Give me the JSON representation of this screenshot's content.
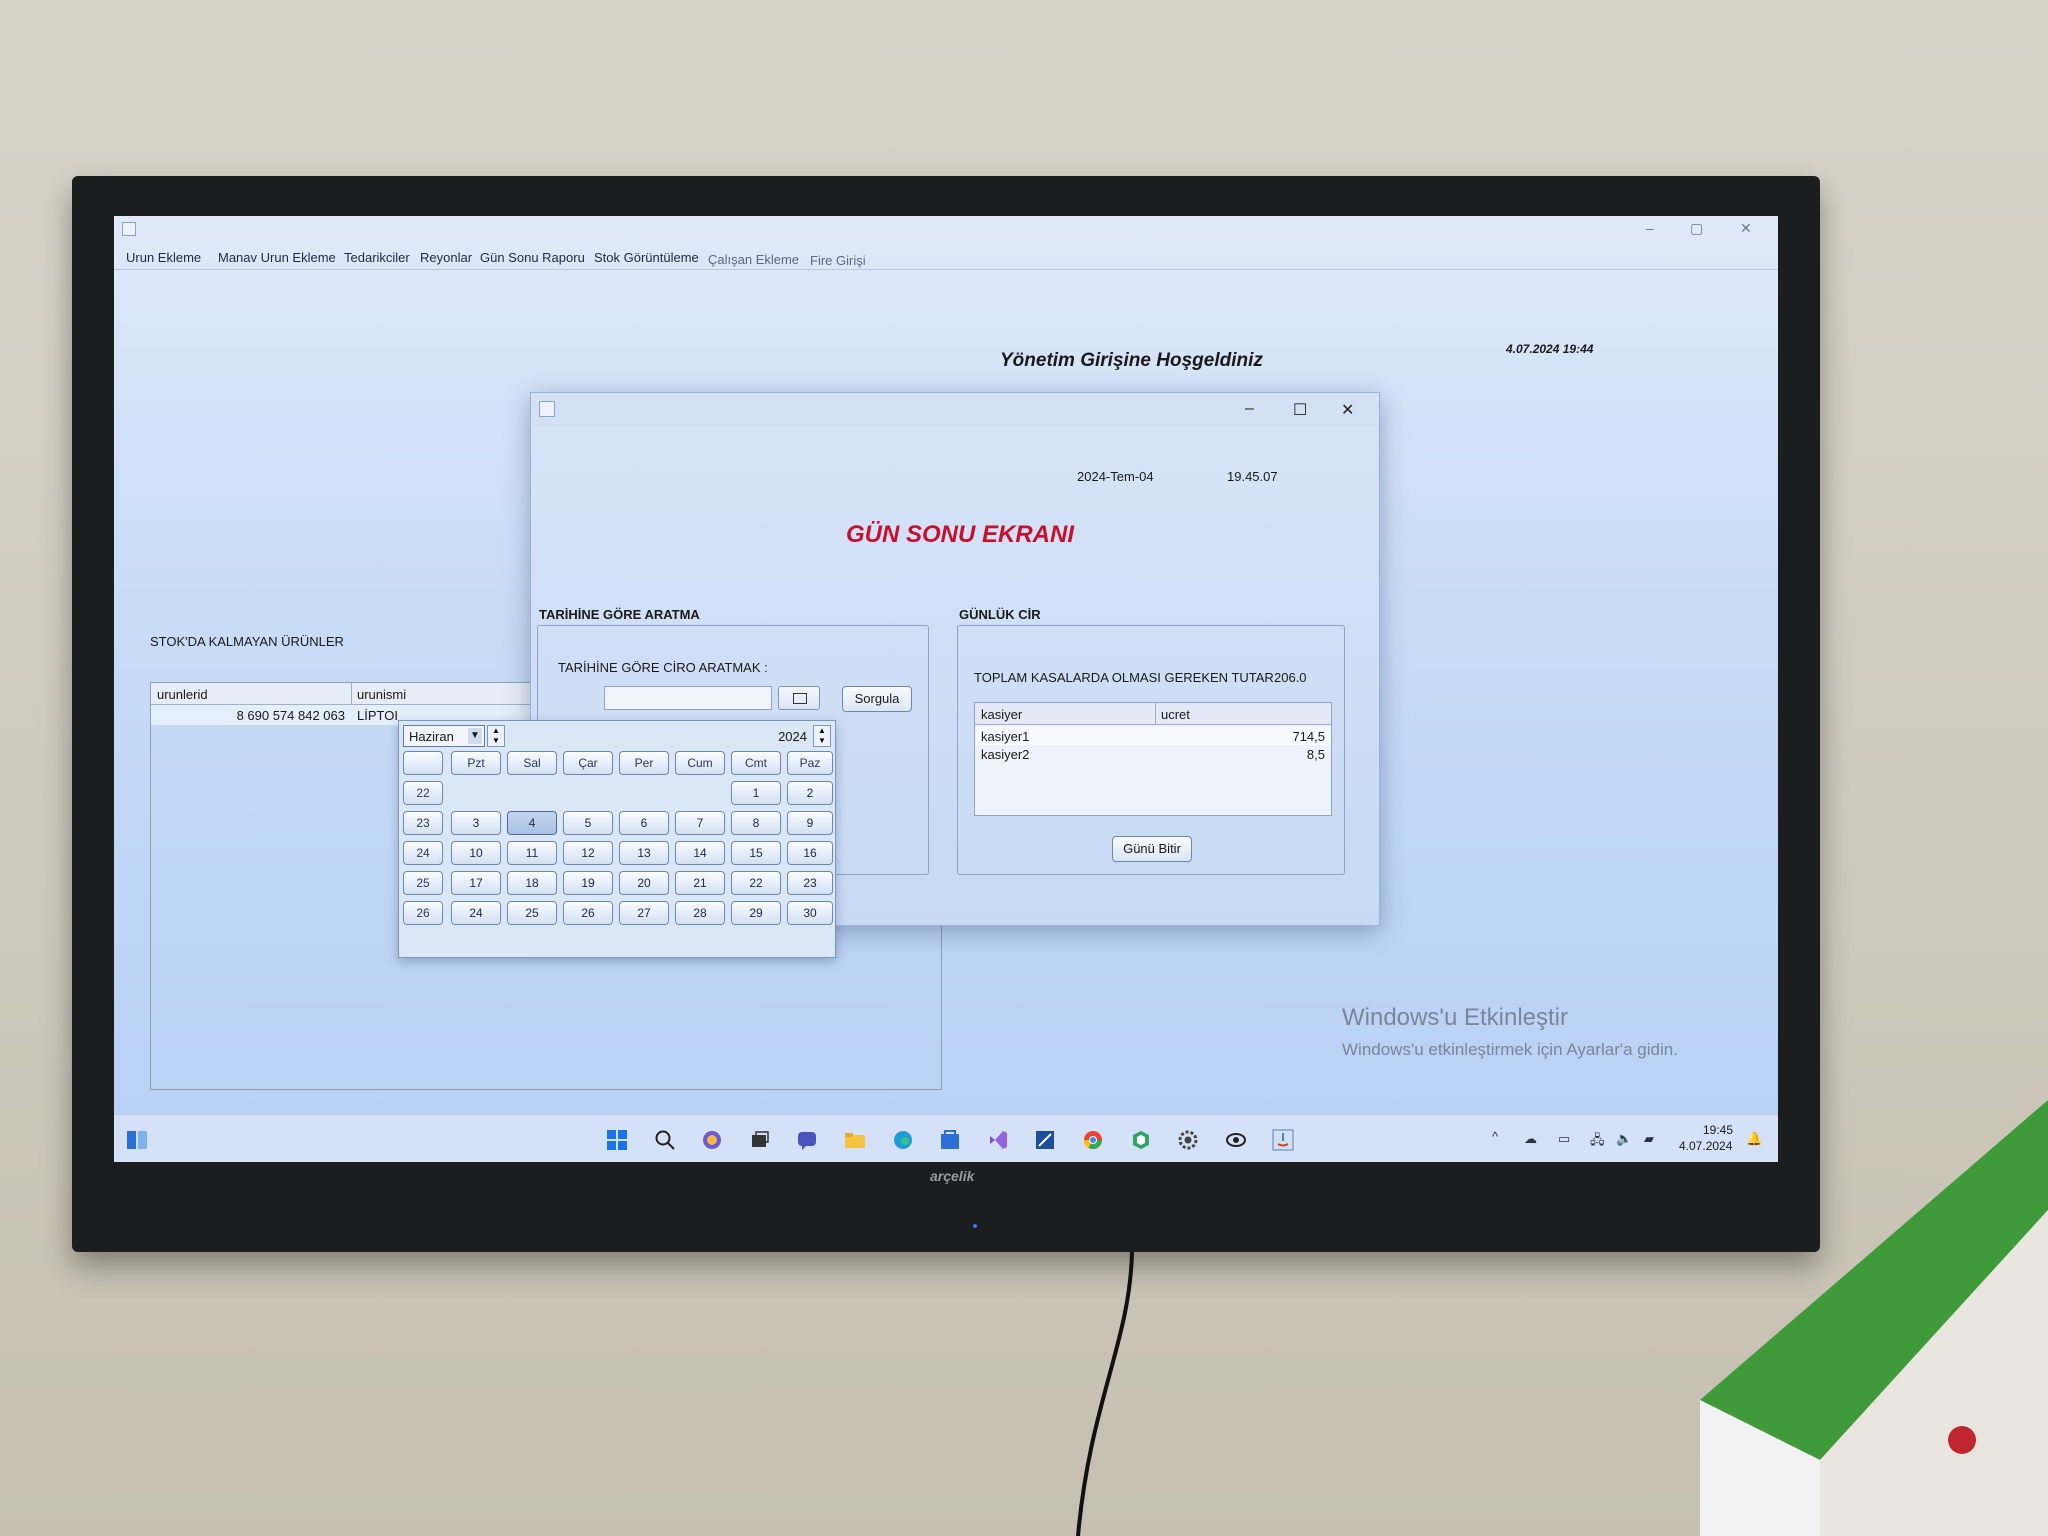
{
  "main_window": {
    "menu": [
      "Urun Ekleme",
      "Manav Urun Ekleme",
      "Tedarikciler",
      "Reyonlar",
      "Gün Sonu Raporu",
      "Stok Görüntüleme",
      "Çalışan Ekleme",
      "Fire Girişi"
    ],
    "welcome": "Yönetim Girişine Hoşgeldiniz",
    "datetime": "4.07.2024 19:44",
    "controls": {
      "minimize": "–",
      "maximize": "▢",
      "close": "✕"
    }
  },
  "stock": {
    "title": "STOK'DA KALMAYAN ÜRÜNLER",
    "columns": [
      "urunlerid",
      "urunismi"
    ],
    "row": {
      "id": "8 690 574 842 063",
      "name": "LİPTOI"
    }
  },
  "watermark": {
    "title": "Windows'u Etkinleştir",
    "subtitle": "Windows'u etkinleştirmek için Ayarlar'a gidin."
  },
  "dialog": {
    "date": "2024-Tem-04",
    "time": "19.45.07",
    "heading": "GÜN SONU EKRANI",
    "controls": {
      "minimize": "–",
      "maximize": "☐",
      "close": "✕"
    },
    "search": {
      "section_title": "TARİHİNE GÖRE ARATMA",
      "label": "TARİHİNE GÖRE CİRO ARATMAK :",
      "date_value": "",
      "button": "Sorgula"
    },
    "daily": {
      "section_title": "GÜNLÜK CİR",
      "total_label": "TOPLAM KASALARDA OLMASI GEREKEN TUTAR",
      "total_value": "206.0",
      "columns": [
        "kasiyer",
        "ucret"
      ],
      "rows": [
        {
          "kasiyer": "kasiyer1",
          "ucret": "714,5"
        },
        {
          "kasiyer": "kasiyer2",
          "ucret": "8,5"
        }
      ],
      "finish_button": "Günü Bitir"
    }
  },
  "calendar": {
    "month": "Haziran",
    "year": "2024",
    "weekday_headers": [
      "",
      "Pzt",
      "Sal",
      "Çar",
      "Per",
      "Cum",
      "Cmt",
      "Paz"
    ],
    "week_numbers": [
      "22",
      "23",
      "24",
      "25",
      "26"
    ],
    "weeks": [
      [
        "",
        "",
        "",
        "",
        "",
        "1",
        "2"
      ],
      [
        "3",
        "4",
        "5",
        "6",
        "7",
        "8",
        "9"
      ],
      [
        "10",
        "11",
        "12",
        "13",
        "14",
        "15",
        "16"
      ],
      [
        "17",
        "18",
        "19",
        "20",
        "21",
        "22",
        "23"
      ],
      [
        "24",
        "25",
        "26",
        "27",
        "28",
        "29",
        "30"
      ]
    ],
    "selected_day": "4"
  },
  "taskbar": {
    "clock_time": "19:45",
    "clock_date": "4.07.2024",
    "icons": [
      "windows-start-icon",
      "search-icon",
      "copilot-icon",
      "task-view-icon",
      "teams-icon",
      "file-explorer-icon",
      "edge-icon",
      "store-icon",
      "visual-studio-icon",
      "netbeans-icon",
      "chrome-icon",
      "cube-app-icon",
      "settings-icon",
      "eye-app-icon",
      "java-app-icon"
    ],
    "tray_chevron": "^"
  },
  "tv": {
    "brand": "arçelik"
  },
  "colors": {
    "heading_red": "#c8102e",
    "screen_blue": "#c9dcf7",
    "bezel": "#1c1d1f"
  }
}
